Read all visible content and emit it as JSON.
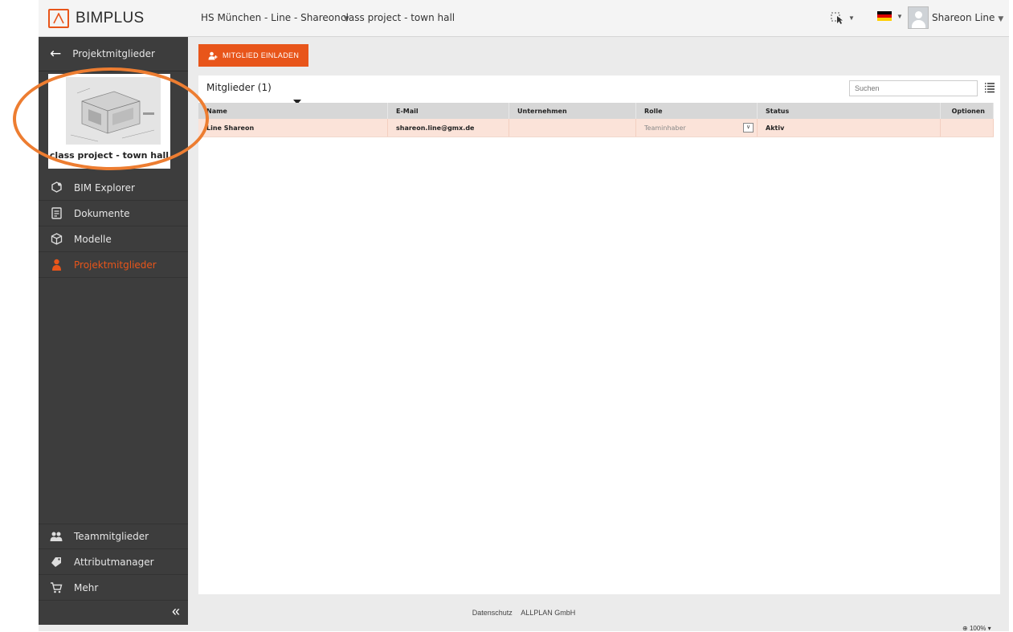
{
  "app": {
    "name": "BIMPLUS"
  },
  "breadcrumb": {
    "team": "HS München - Line - Shareon",
    "project": "class project - town hall"
  },
  "user": {
    "name": "Shareon Line"
  },
  "sidebar": {
    "header": "Projektmitglieder",
    "project_name": "class project - town hall",
    "items": [
      {
        "label": "BIM Explorer",
        "icon": "cubes-icon"
      },
      {
        "label": "Dokumente",
        "icon": "document-icon"
      },
      {
        "label": "Modelle",
        "icon": "model-icon"
      },
      {
        "label": "Projektmitglieder",
        "icon": "person-icon",
        "active": true
      }
    ],
    "bottom_items": [
      {
        "label": "Teammitglieder",
        "icon": "team-icon"
      },
      {
        "label": "Attributmanager",
        "icon": "tag-icon"
      },
      {
        "label": "Mehr",
        "icon": "cart-icon"
      }
    ],
    "collapse_glyph": "«"
  },
  "main": {
    "invite_button": "MITGLIED EINLADEN",
    "panel_title": "Mitglieder (1)",
    "search_placeholder": "Suchen",
    "columns": [
      "Name",
      "E-Mail",
      "Unternehmen",
      "Rolle",
      "Status",
      "Optionen"
    ],
    "rows": [
      {
        "name": "Line Shareon",
        "email": "shareon.line@gmx.de",
        "company": "",
        "role": "Teaminhaber",
        "status": "Aktiv",
        "options": ""
      }
    ]
  },
  "footer": {
    "privacy": "Datenschutz",
    "company": "ALLPLAN GmbH"
  },
  "zoom": "100%",
  "colors": {
    "accent": "#e8551a",
    "sidebar": "#3d3d3d",
    "row_highlight": "#fbe3d9",
    "annotation": "#ed7d31"
  }
}
